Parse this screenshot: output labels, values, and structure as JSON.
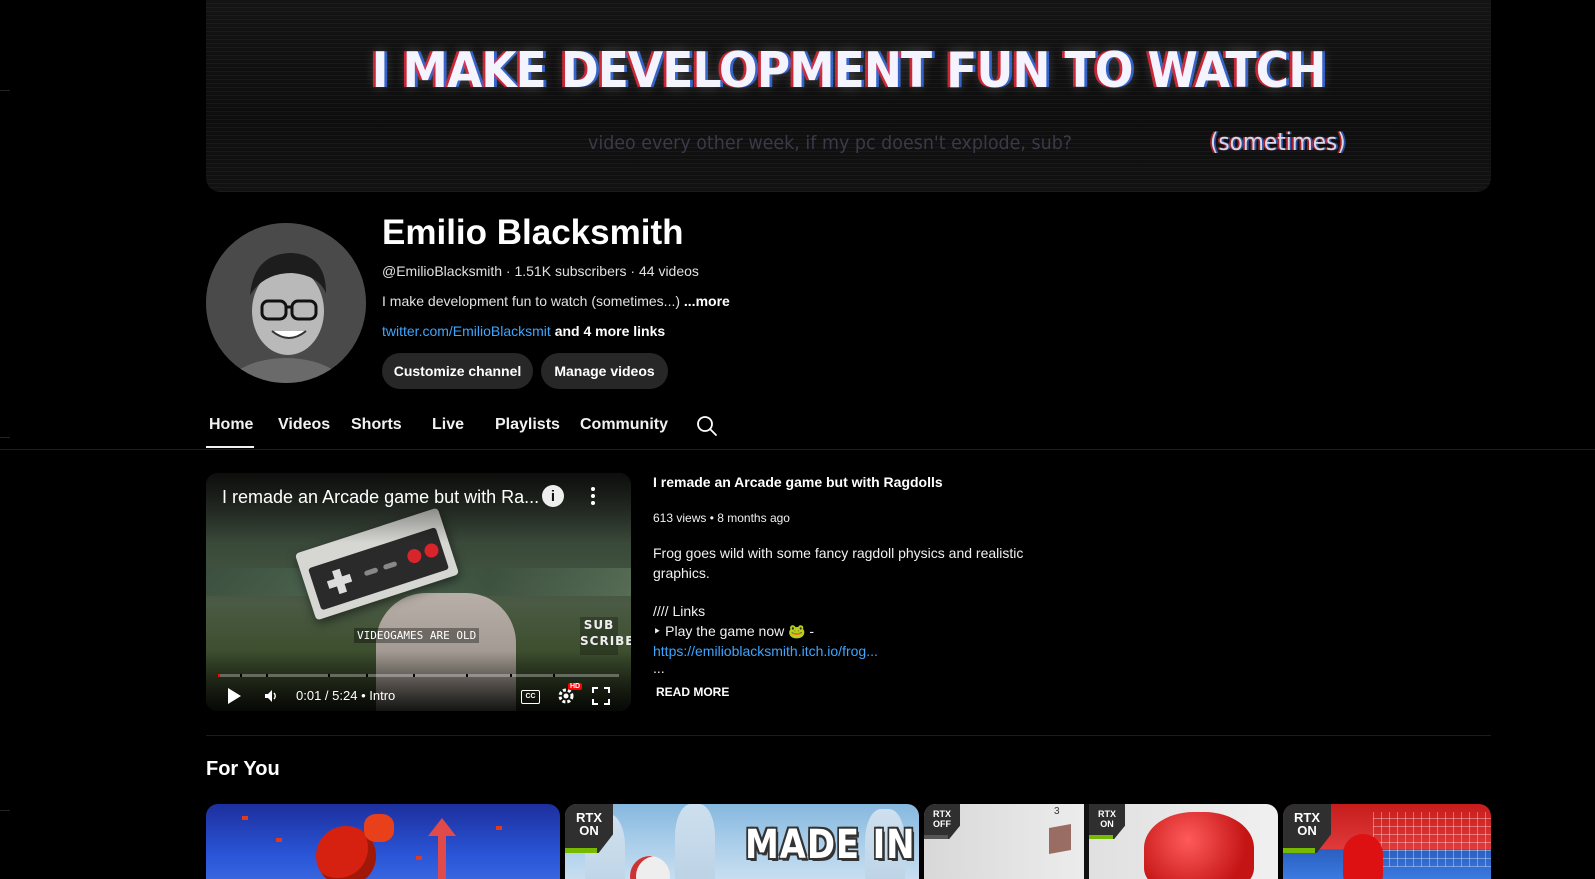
{
  "banner": {
    "headline": "I MAKE DEVELOPMENT FUN TO WATCH",
    "subline": "video every other week, if my pc doesn't explode, sub?",
    "aside": "(sometimes)"
  },
  "channel": {
    "name": "Emilio Blacksmith",
    "handle": "@EmilioBlacksmith",
    "subscribers": "1.51K subscribers",
    "videos": "44 videos",
    "meta_separator": " · ",
    "description": "I make development fun to watch (sometimes...)",
    "description_more": "...more",
    "link": "twitter.com/EmilioBlacksmit",
    "more_links": "and 4 more links",
    "customize_label": "Customize channel",
    "manage_label": "Manage videos"
  },
  "tabs": [
    {
      "label": "Home",
      "selected": true
    },
    {
      "label": "Videos"
    },
    {
      "label": "Shorts"
    },
    {
      "label": "Live"
    },
    {
      "label": "Playlists"
    },
    {
      "label": "Community"
    }
  ],
  "featured": {
    "player_title": "I remade an Arcade game but with Ra...",
    "overlay_caption": "VIDEOGAMES ARE OLD",
    "overlay_badge": "SUB SCRIBE",
    "time": "0:01 / 5:24",
    "chapter": "Intro",
    "hd": "HD",
    "cc": "CC",
    "progress_fraction": 0.003,
    "title": "I remade an Arcade game but with Ragdolls",
    "views": "613 views",
    "age": "8 months ago",
    "meta_separator": " • ",
    "description": "Frog goes wild with some fancy ragdoll physics and realistic graphics.",
    "links_header": "//// Links",
    "play_line": "‣  Play the game now 🐸 -",
    "url": "https://emilioblacksmith.itch.io/frog...",
    "ellipsis": "...",
    "read_more": "READ MORE"
  },
  "for_you": {
    "heading": "For You",
    "thumb2_text": "MADE IN",
    "rtx_on": [
      "RTX",
      "ON"
    ],
    "rtx_off": [
      "RTX",
      "OFF"
    ],
    "thumb3_number": "3"
  },
  "colors": {
    "background": "#000000",
    "button_bg": "#272727",
    "link": "#3ea6ff",
    "progress": "#ff0000",
    "rtx_green": "#76b900"
  },
  "icons": [
    "search-icon",
    "info-icon",
    "kebab-icon",
    "play-icon",
    "volume-icon",
    "cc-icon",
    "gear-icon",
    "fullscreen-icon"
  ]
}
